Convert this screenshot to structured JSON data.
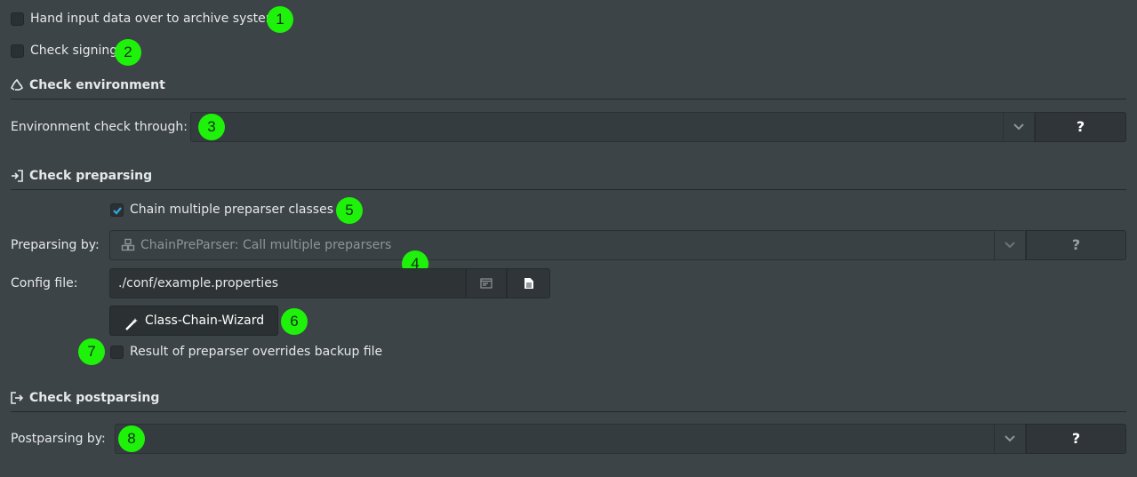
{
  "options": {
    "hand_input": {
      "label": "Hand input data over to archive system",
      "checked": false
    },
    "check_signing": {
      "label": "Check signing",
      "checked": false
    }
  },
  "sections": {
    "environment": {
      "title": "Check environment",
      "icon": "recycle-icon"
    },
    "preparsing": {
      "title": "Check preparsing",
      "icon": "sign-in-icon"
    },
    "postparsing": {
      "title": "Check postparsing",
      "icon": "sign-out-icon"
    }
  },
  "environment": {
    "label": "Environment check through:",
    "value": "",
    "help_label": "?"
  },
  "preparsing": {
    "chain_label": "Chain multiple preparser classes",
    "chain_checked": true,
    "by_label": "Preparsing by:",
    "by_value": "ChainPreParser: Call multiple preparsers",
    "by_value_icon": "cubes-icon",
    "help_label": "?",
    "config_label": "Config file:",
    "config_value": "./conf/example.properties",
    "wizard_label": "Class-Chain-Wizard",
    "override_label": "Result of preparser overrides backup file",
    "override_checked": false
  },
  "postparsing": {
    "by_label": "Postparsing by:",
    "value": "",
    "help_label": "?"
  },
  "badges": [
    "1",
    "2",
    "3",
    "4",
    "5",
    "6",
    "7",
    "8"
  ],
  "colors": {
    "background": "#3d4447",
    "badge": "#1ef20a",
    "check_accent": "#35a6e0"
  }
}
